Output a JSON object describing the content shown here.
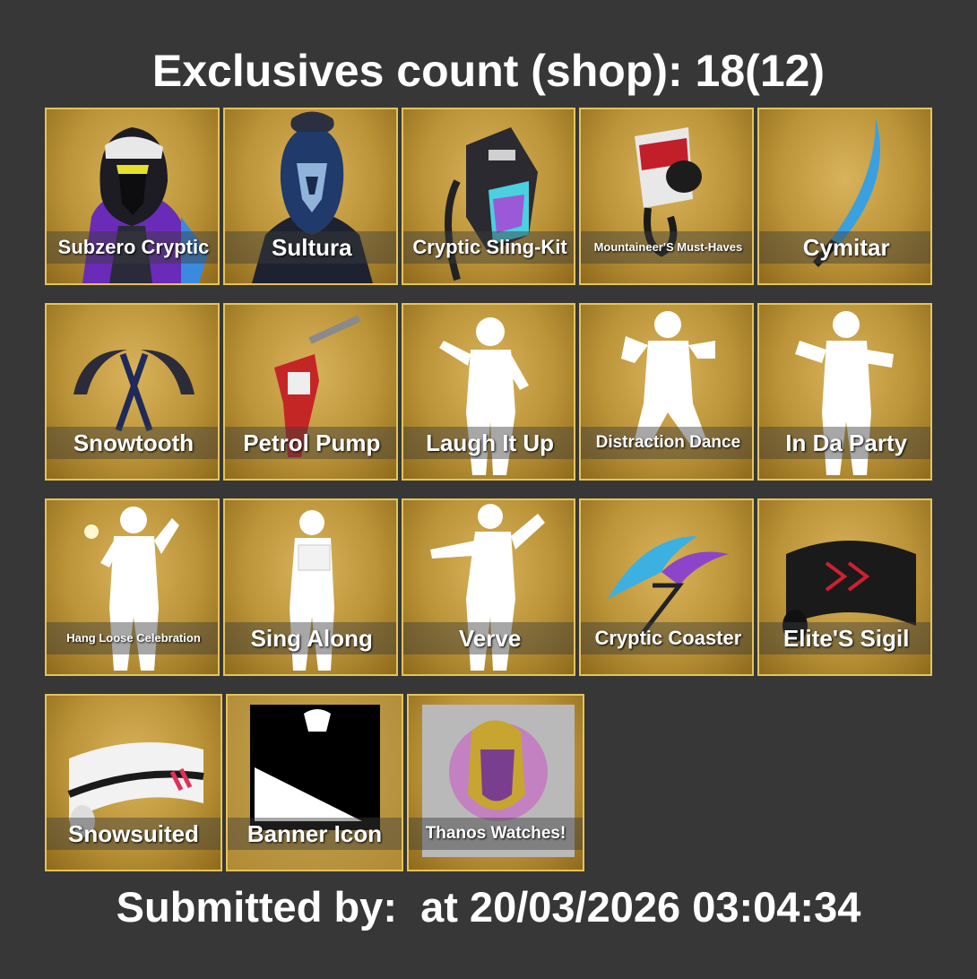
{
  "header": {
    "title": "Exclusives count (shop): 18(12)"
  },
  "items": [
    {
      "name": "Subzero Cryptic",
      "icon": "outfit-icon"
    },
    {
      "name": "Sultura",
      "icon": "outfit-icon"
    },
    {
      "name": "Cryptic Sling-Kit",
      "icon": "backbling-icon"
    },
    {
      "name": "Mountaineer'S Must-Haves",
      "icon": "backbling-icon"
    },
    {
      "name": "Cymitar",
      "icon": "pickaxe-icon"
    },
    {
      "name": "Snowtooth",
      "icon": "pickaxe-icon"
    },
    {
      "name": "Petrol Pump",
      "icon": "pickaxe-icon"
    },
    {
      "name": "Laugh It Up",
      "icon": "emote-icon"
    },
    {
      "name": "Distraction Dance",
      "icon": "emote-icon"
    },
    {
      "name": "In Da Party",
      "icon": "emote-icon"
    },
    {
      "name": "Hang Loose Celebration",
      "icon": "emote-icon"
    },
    {
      "name": "Sing Along",
      "icon": "emote-icon"
    },
    {
      "name": "Verve",
      "icon": "emote-icon"
    },
    {
      "name": "Cryptic Coaster",
      "icon": "glider-icon"
    },
    {
      "name": "Elite'S Sigil",
      "icon": "wrap-icon"
    },
    {
      "name": "Snowsuited",
      "icon": "wrap-icon"
    },
    {
      "name": "Banner Icon",
      "icon": "banner-icon"
    },
    {
      "name": "Thanos Watches!",
      "icon": "spray-icon"
    }
  ],
  "footer": {
    "text": "Submitted by:  at 20/03/2026 03:04:34"
  }
}
